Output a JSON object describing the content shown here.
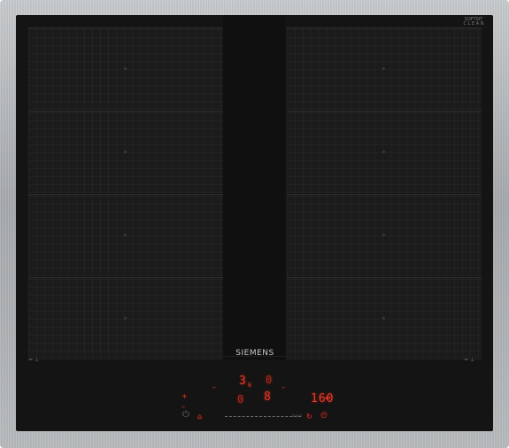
{
  "brand": "SIEMENS",
  "badge": {
    "line1": "SOFTSIT",
    "line2": "C L E A N"
  },
  "zones": {
    "left": [
      "zone-left-1",
      "zone-left-2",
      "zone-left-3",
      "zone-left-4"
    ],
    "right": [
      "zone-right-1",
      "zone-right-2",
      "zone-right-3",
      "zone-right-4"
    ]
  },
  "left_zone_label": "≈ ⊥",
  "right_zone_label": "≈ ⊥",
  "controls": {
    "display_top_left": "3",
    "display_top_left_suffix": "k",
    "display_top_right": "0",
    "display_mid_left": "0",
    "display_mid_right": "8",
    "timer_display": "160",
    "power_icon": "⏻",
    "lock_icon": "⌂",
    "slider_label": "boost",
    "plus_icon": "+",
    "minus_icon": "–",
    "timer_icon": "⏲",
    "alarm_icon": "⏰",
    "extra_icon": "↻"
  },
  "colors": {
    "display_red": "#e03a2a",
    "glass": "#141414",
    "steel": "#b5b8ba"
  }
}
